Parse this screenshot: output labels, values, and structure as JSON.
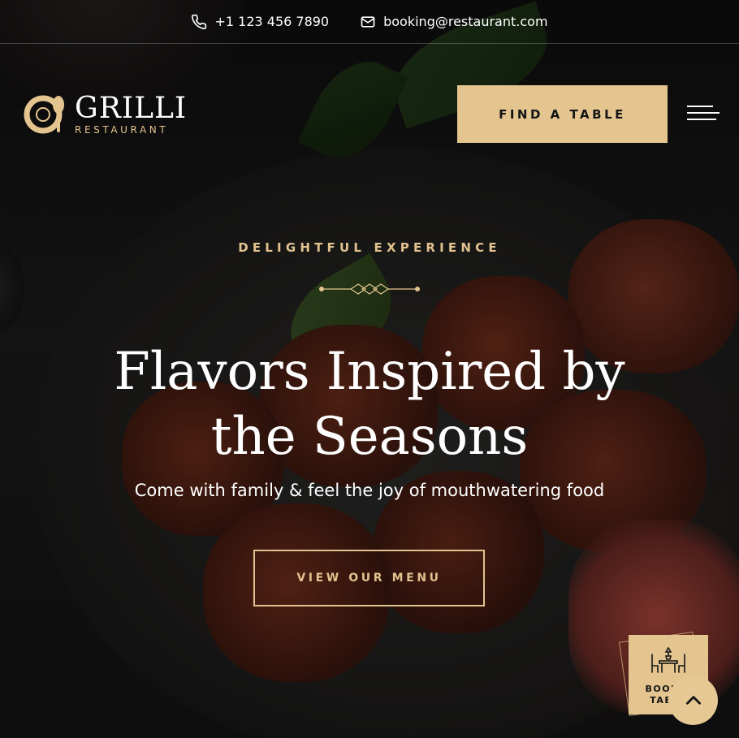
{
  "topbar": {
    "phone": "+1 123 456 7890",
    "email": "booking@restaurant.com",
    "phone_icon": "phone-icon",
    "email_icon": "mail-icon"
  },
  "header": {
    "logo_name": "GRILLI",
    "logo_sub": "RESTAURANT",
    "find_table_label": "FIND A TABLE",
    "menu_icon": "hamburger-menu-icon"
  },
  "hero": {
    "eyebrow": "DELIGHTFUL EXPERIENCE",
    "headline": "Flavors Inspired by the Seasons",
    "tagline": "Come with family & feel the joy of mouthwatering food",
    "menu_button_label": "VIEW OUR MENU"
  },
  "widgets": {
    "book_table_label": "BOOK A TABLE",
    "book_icon": "dining-table-icon",
    "scroll_top_icon": "chevron-up-icon"
  },
  "colors": {
    "accent": "#e4c590",
    "text": "#ffffff",
    "background": "#131313"
  }
}
